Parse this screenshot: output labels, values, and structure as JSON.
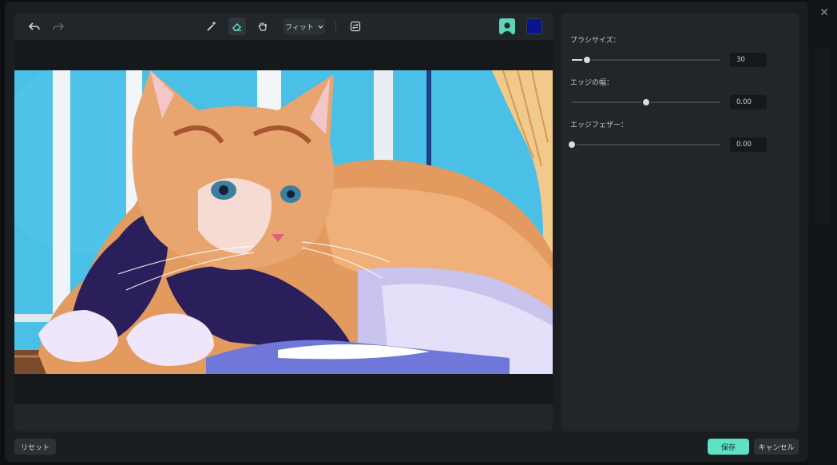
{
  "toolbar": {
    "undo_icon": "undo-icon",
    "redo_icon": "redo-icon",
    "brush_icon": "brush-plus-icon",
    "eraser_icon": "eraser-icon",
    "hand_icon": "hand-icon",
    "fit_label": "フィット",
    "compare_icon": "compare-icon",
    "person_icon": "person-icon",
    "swatch_color": "#0a1490"
  },
  "panel": {
    "brush_size_label": "ブラシサイズ：",
    "brush_size_value": "30",
    "brush_size_level": 0.1,
    "edge_width_label": "エッジの幅：",
    "edge_width_value": "0.00",
    "edge_width_level": 0.5,
    "edge_feather_label": "エッジフェザー：",
    "edge_feather_value": "0.00",
    "edge_feather_level": 0.0
  },
  "footer": {
    "reset_label": "リセット",
    "save_label": "保存",
    "cancel_label": "キャンセル"
  },
  "colors": {
    "accent": "#5fe2c2",
    "dialog_bg": "#1a1e21",
    "panel_bg": "#20262a"
  }
}
